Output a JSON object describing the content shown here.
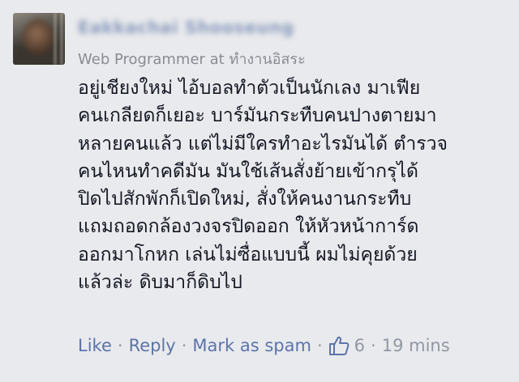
{
  "comment": {
    "author_name": "Eakkachai Shooseung",
    "author_subtitle": "Web Programmer at ทำงานอิสระ",
    "body_lines": [
      "อยู่เชียงใหม่ ไอ้บอลทำตัวเป็นนักเลง มาเฟีย",
      "คนเกลียดก็เยอะ บาร์มันกระทืบคนปางตายมา",
      "หลายคนแล้ว แต่ไม่มีใครทำอะไรมันได้ ตำรวจ",
      "คนไหนทำคดีมัน มันใช้เส้นสั่งย้ายเข้ากรุได้",
      "ปิดไปสักพักก็เปิดใหม่, สั่งให้คนงานกระทืบ",
      "แถมถอดกล้องวงจรปิดออก ให้หัวหน้าการ์ด",
      "ออกมาโกหก เล่นไม่ซื่อแบบนี้ ผมไม่คุยด้วย",
      "แล้วล่ะ ดิบมาก็ดิบไป"
    ]
  },
  "actions": {
    "like_label": "Like",
    "reply_label": "Reply",
    "spam_label": "Mark as spam",
    "separator": "·",
    "like_count": "6",
    "timestamp": "19 mins",
    "thumb_icon": "thumbs-up-icon"
  },
  "colors": {
    "link": "#5b74a8",
    "meta": "#9197a3",
    "background": "#e9eaed"
  }
}
